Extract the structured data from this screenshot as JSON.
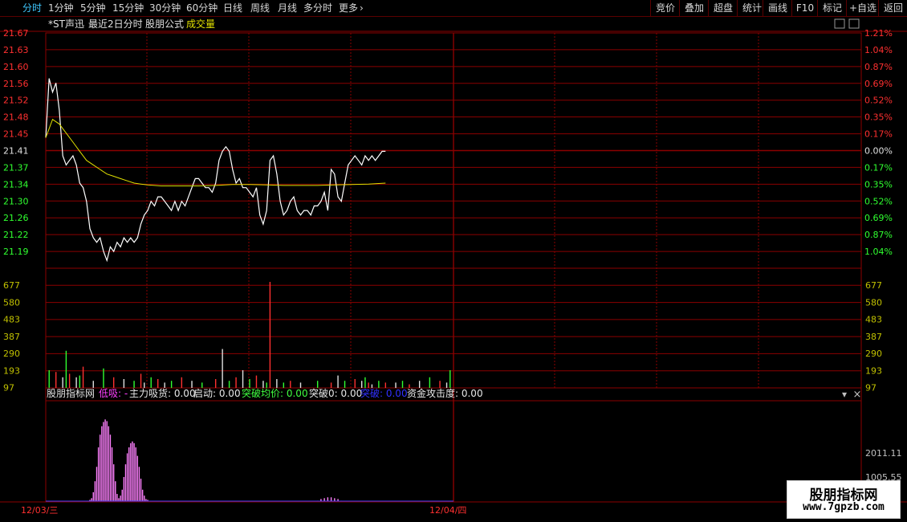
{
  "toolbar": {
    "periods": [
      "分时",
      "1分钟",
      "5分钟",
      "15分钟",
      "30分钟",
      "60分钟",
      "日线",
      "周线",
      "月线",
      "多分时"
    ],
    "more": "更多",
    "right": [
      "竞价",
      "叠加",
      "超盘",
      "统计",
      "画线",
      "F10",
      "标记",
      "+自选",
      "返回"
    ]
  },
  "header": {
    "stock": "*ST声迅",
    "mode": "最近2日分时",
    "formula": "股朋公式",
    "volume_label": "成交量"
  },
  "indicator": {
    "name": "股朋指标网",
    "items": [
      {
        "label": "低吸: -",
        "color": "#ff40ff"
      },
      {
        "label": "主力吸货: 0.00",
        "color": "#e8e8e8"
      },
      {
        "label": "启动: 0.00",
        "color": "#e8e8e8"
      },
      {
        "label": "突破均价: 0.00",
        "color": "#40ff40"
      },
      {
        "label": "突破0: 0.00",
        "color": "#e8e8e8"
      },
      {
        "label": "突破: 0.00",
        "color": "#3030ff"
      },
      {
        "label": "资金攻击度: 0.00",
        "color": "#e8e8e8"
      }
    ],
    "axis_labels": [
      "2011.11",
      "1005.55"
    ]
  },
  "dates": [
    "12/03/三",
    "12/04/四"
  ],
  "watermark": {
    "title": "股朋指标网",
    "url": "www.7gpzb.com"
  },
  "colors": {
    "up": "#ff3030",
    "down": "#30ff30",
    "grid": "#8b0000",
    "price": "#ffffff",
    "avg": "#e0e000",
    "vol": "#c0c000",
    "indicator": "#ff80ff"
  },
  "chart_data": [
    {
      "type": "line",
      "name": "intraday-price",
      "x_range": [
        0,
        240
      ],
      "ylim": [
        21.15,
        21.67
      ],
      "prev_close": 21.41,
      "price_ticks": [
        "21.67",
        "21.63",
        "21.60",
        "21.56",
        "21.52",
        "21.48",
        "21.45",
        "21.41",
        "21.37",
        "21.34",
        "21.30",
        "21.26",
        "21.22",
        "21.19"
      ],
      "pct_ticks": [
        "1.21%",
        "1.04%",
        "0.87%",
        "0.69%",
        "0.52%",
        "0.35%",
        "0.17%",
        "0.00%",
        "0.17%",
        "0.35%",
        "0.52%",
        "0.69%",
        "0.87%",
        "1.04%"
      ],
      "series": [
        {
          "x": [
            0,
            2,
            4,
            6,
            8,
            10,
            12,
            14,
            16,
            18,
            20,
            22,
            24,
            26,
            28,
            30,
            32,
            34,
            36,
            38,
            40,
            42,
            44,
            46,
            48,
            50,
            52,
            54,
            56,
            58,
            60,
            62,
            64,
            66,
            68,
            70,
            72,
            74,
            76,
            78,
            80,
            82,
            84,
            86,
            88,
            90,
            92,
            94,
            96,
            98,
            100,
            102,
            104,
            106,
            108,
            110,
            112,
            114,
            116,
            118,
            120,
            122,
            124,
            126,
            128,
            130,
            132,
            134,
            136,
            138,
            140,
            142,
            144,
            146,
            148,
            150,
            152,
            154,
            156,
            158,
            160,
            162,
            164,
            166,
            168,
            170,
            172,
            174,
            176,
            178,
            180,
            182,
            184,
            186,
            188,
            190,
            192,
            194,
            196,
            198,
            200,
            202,
            204,
            206,
            208,
            210,
            212,
            214,
            216,
            218,
            220,
            222,
            224,
            226,
            228,
            230,
            232,
            234,
            236,
            238,
            240
          ],
          "values": [
            21.44,
            21.57,
            21.54,
            21.56,
            21.5,
            21.4,
            21.38,
            21.39,
            21.4,
            21.38,
            21.34,
            21.33,
            21.3,
            21.24,
            21.22,
            21.21,
            21.22,
            21.19,
            21.17,
            21.2,
            21.19,
            21.21,
            21.2,
            21.22,
            21.21,
            21.22,
            21.21,
            21.22,
            21.25,
            21.27,
            21.28,
            21.3,
            21.29,
            21.31,
            21.31,
            21.3,
            21.29,
            21.28,
            21.3,
            21.28,
            21.3,
            21.29,
            21.31,
            21.33,
            21.35,
            21.35,
            21.34,
            21.33,
            21.33,
            21.32,
            21.34,
            21.39,
            21.41,
            21.42,
            21.41,
            21.37,
            21.34,
            21.35,
            21.33,
            21.33,
            21.32,
            21.31,
            21.33,
            21.27,
            21.25,
            21.28,
            21.39,
            21.4,
            21.36,
            21.3,
            21.27,
            21.28,
            21.3,
            21.31,
            21.28,
            21.27,
            21.28,
            21.28,
            21.27,
            21.29,
            21.29,
            21.3,
            21.32,
            21.28,
            21.37,
            21.36,
            21.31,
            21.3,
            21.34,
            21.38,
            21.39,
            21.4,
            21.39,
            21.38,
            21.4,
            21.39,
            21.4,
            21.39,
            21.4,
            21.41,
            21.41,
            null,
            null,
            null,
            null,
            null,
            null,
            null,
            null,
            null,
            null,
            null,
            null,
            null,
            null,
            null,
            null,
            null,
            null,
            null,
            null
          ]
        },
        {
          "name": "avg",
          "x": [
            0,
            4,
            8,
            12,
            16,
            20,
            24,
            28,
            32,
            36,
            40,
            44,
            48,
            52,
            56,
            60,
            64,
            68,
            72,
            80,
            90,
            100,
            110,
            120,
            130,
            140,
            150,
            160,
            170,
            180,
            190,
            200
          ],
          "values": [
            21.44,
            21.48,
            21.47,
            21.45,
            21.43,
            21.41,
            21.39,
            21.38,
            21.37,
            21.36,
            21.355,
            21.35,
            21.345,
            21.34,
            21.338,
            21.336,
            21.335,
            21.334,
            21.334,
            21.334,
            21.334,
            21.335,
            21.337,
            21.337,
            21.336,
            21.335,
            21.335,
            21.335,
            21.336,
            21.337,
            21.338,
            21.34
          ]
        }
      ]
    },
    {
      "type": "bar",
      "name": "volume",
      "ylim": [
        0,
        677
      ],
      "ticks": [
        "677",
        "580",
        "483",
        "387",
        "290",
        "193",
        "97"
      ],
      "x": [
        2,
        6,
        10,
        12,
        14,
        18,
        20,
        22,
        28,
        34,
        40,
        46,
        52,
        56,
        58,
        62,
        66,
        70,
        74,
        80,
        86,
        92,
        100,
        104,
        108,
        112,
        116,
        120,
        124,
        128,
        130,
        132,
        136,
        140,
        144,
        150,
        160,
        168,
        172,
        176,
        182,
        186,
        188,
        190,
        192,
        196,
        200,
        206,
        210,
        214,
        220,
        226,
        232,
        236,
        238
      ],
      "values": [
        100,
        90,
        60,
        210,
        80,
        60,
        70,
        120,
        40,
        110,
        60,
        50,
        40,
        80,
        30,
        60,
        50,
        30,
        40,
        60,
        40,
        30,
        50,
        220,
        40,
        60,
        100,
        50,
        70,
        40,
        30,
        600,
        50,
        30,
        40,
        30,
        40,
        30,
        70,
        40,
        50,
        40,
        60,
        30,
        20,
        40,
        30,
        30,
        40,
        20,
        40,
        60,
        40,
        30,
        100
      ]
    },
    {
      "type": "bar",
      "name": "indicator",
      "ylim": [
        1005.55,
        2011.11
      ],
      "x": [
        26,
        27,
        28,
        29,
        30,
        31,
        32,
        33,
        34,
        35,
        36,
        37,
        38,
        39,
        40,
        41,
        42,
        43,
        44,
        45,
        46,
        47,
        48,
        49,
        50,
        51,
        52,
        53,
        54,
        55,
        56,
        57,
        58,
        59,
        60,
        61,
        62,
        63,
        64,
        65,
        66,
        67,
        160,
        162,
        164,
        166,
        168,
        170,
        172,
        174
      ],
      "values": [
        1030,
        1050,
        1120,
        1250,
        1420,
        1650,
        1800,
        1900,
        1950,
        1980,
        1960,
        1900,
        1800,
        1650,
        1450,
        1250,
        1100,
        1050,
        1080,
        1150,
        1300,
        1450,
        1580,
        1650,
        1700,
        1720,
        1700,
        1650,
        1550,
        1420,
        1280,
        1150,
        1080,
        1040,
        1030,
        1020,
        1015,
        1010,
        1010,
        1012,
        1010,
        1008,
        1020,
        1040,
        1050,
        1060,
        1060,
        1050,
        1040,
        1020
      ]
    }
  ]
}
